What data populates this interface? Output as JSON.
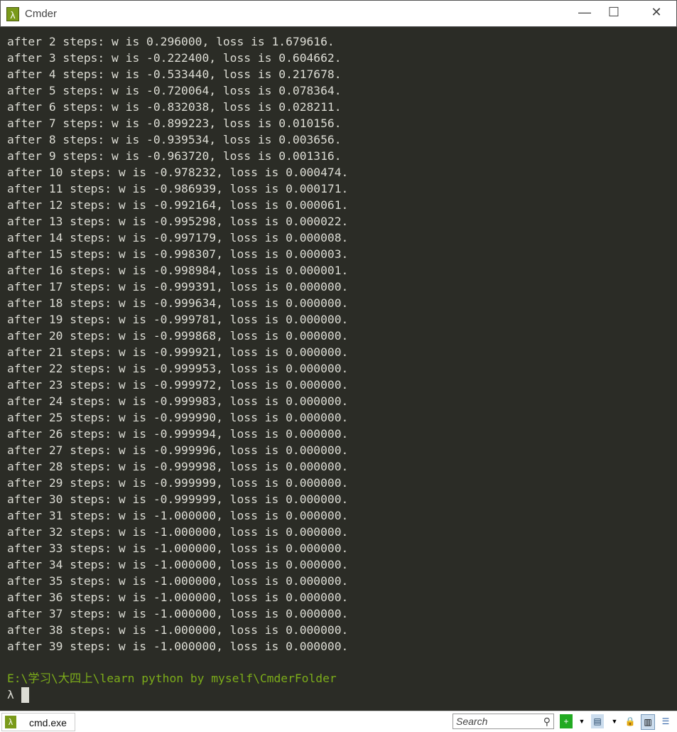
{
  "window": {
    "title": "Cmder",
    "app_icon": "lambda-icon",
    "minimize": "—",
    "maximize": "☐",
    "close": "✕"
  },
  "output_lines": [
    "after 2 steps: w is 0.296000, loss is 1.679616.",
    "after 3 steps: w is -0.222400, loss is 0.604662.",
    "after 4 steps: w is -0.533440, loss is 0.217678.",
    "after 5 steps: w is -0.720064, loss is 0.078364.",
    "after 6 steps: w is -0.832038, loss is 0.028211.",
    "after 7 steps: w is -0.899223, loss is 0.010156.",
    "after 8 steps: w is -0.939534, loss is 0.003656.",
    "after 9 steps: w is -0.963720, loss is 0.001316.",
    "after 10 steps: w is -0.978232, loss is 0.000474.",
    "after 11 steps: w is -0.986939, loss is 0.000171.",
    "after 12 steps: w is -0.992164, loss is 0.000061.",
    "after 13 steps: w is -0.995298, loss is 0.000022.",
    "after 14 steps: w is -0.997179, loss is 0.000008.",
    "after 15 steps: w is -0.998307, loss is 0.000003.",
    "after 16 steps: w is -0.998984, loss is 0.000001.",
    "after 17 steps: w is -0.999391, loss is 0.000000.",
    "after 18 steps: w is -0.999634, loss is 0.000000.",
    "after 19 steps: w is -0.999781, loss is 0.000000.",
    "after 20 steps: w is -0.999868, loss is 0.000000.",
    "after 21 steps: w is -0.999921, loss is 0.000000.",
    "after 22 steps: w is -0.999953, loss is 0.000000.",
    "after 23 steps: w is -0.999972, loss is 0.000000.",
    "after 24 steps: w is -0.999983, loss is 0.000000.",
    "after 25 steps: w is -0.999990, loss is 0.000000.",
    "after 26 steps: w is -0.999994, loss is 0.000000.",
    "after 27 steps: w is -0.999996, loss is 0.000000.",
    "after 28 steps: w is -0.999998, loss is 0.000000.",
    "after 29 steps: w is -0.999999, loss is 0.000000.",
    "after 30 steps: w is -0.999999, loss is 0.000000.",
    "after 31 steps: w is -1.000000, loss is 0.000000.",
    "after 32 steps: w is -1.000000, loss is 0.000000.",
    "after 33 steps: w is -1.000000, loss is 0.000000.",
    "after 34 steps: w is -1.000000, loss is 0.000000.",
    "after 35 steps: w is -1.000000, loss is 0.000000.",
    "after 36 steps: w is -1.000000, loss is 0.000000.",
    "after 37 steps: w is -1.000000, loss is 0.000000.",
    "after 38 steps: w is -1.000000, loss is 0.000000.",
    "after 39 steps: w is -1.000000, loss is 0.000000."
  ],
  "prompt": {
    "path": "E:\\学习\\大四上\\learn python by myself\\CmderFolder",
    "symbol": "λ"
  },
  "statusbar": {
    "tab_label": "cmd.exe",
    "search_placeholder": "Search"
  },
  "colors": {
    "background": "#2b2c26",
    "text": "#dcdcd4",
    "prompt": "#7cac1a",
    "accent": "#7a9a1a"
  }
}
